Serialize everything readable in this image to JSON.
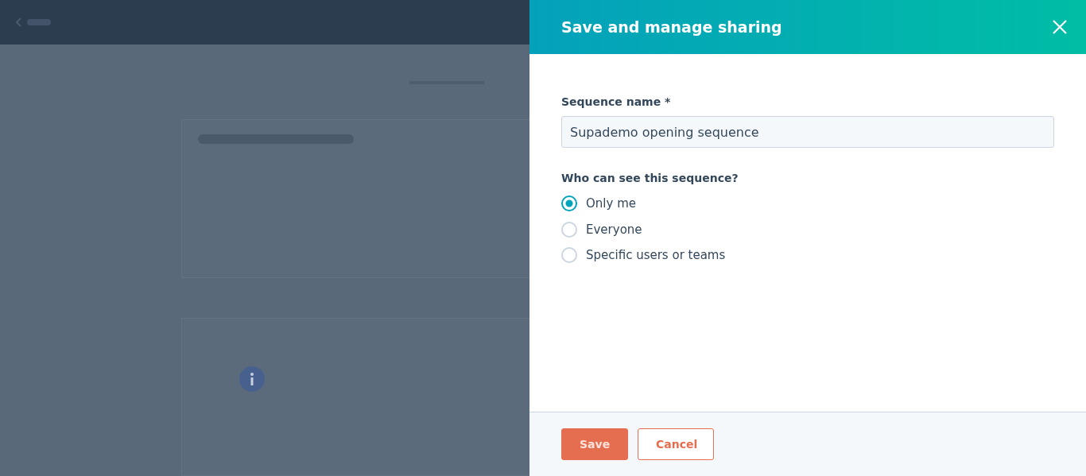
{
  "panel": {
    "title": "Save and manage sharing",
    "name_field": {
      "label": "Sequence name *",
      "value": "Supademo opening sequence"
    },
    "visibility": {
      "label": "Who can see this sequence?",
      "options": [
        {
          "label": "Only me",
          "selected": true
        },
        {
          "label": "Everyone",
          "selected": false
        },
        {
          "label": "Specific users or teams",
          "selected": false
        }
      ]
    },
    "buttons": [
      {
        "label": "Save",
        "kind": "primary"
      },
      {
        "label": "Cancel",
        "kind": "secondary"
      }
    ]
  }
}
